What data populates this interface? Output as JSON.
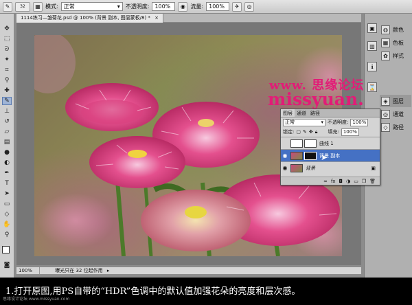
{
  "options_bar": {
    "brush_size": "32",
    "mode_label": "模式:",
    "mode_value": "正常",
    "opacity_label": "不透明度:",
    "opacity_value": "100%",
    "flow_label": "流量:",
    "flow_value": "100%"
  },
  "document": {
    "tab_title": "1114练习—雏菊花.psd @ 100% (背景 副本, 图层蒙板/8) *",
    "tab_close": "×",
    "zoom": "100%",
    "status_text": "曝光只在 32 位起作用"
  },
  "dock": {
    "items": [
      {
        "label": "颜色",
        "icon": "color-icon"
      },
      {
        "label": "色板",
        "icon": "swatches-icon"
      },
      {
        "label": "样式",
        "icon": "styles-icon"
      },
      {
        "label": "图层",
        "icon": "layers-icon"
      },
      {
        "label": "通道",
        "icon": "channels-icon"
      },
      {
        "label": "路径",
        "icon": "paths-icon"
      }
    ]
  },
  "layers_panel": {
    "tabs": [
      "图层",
      "通道",
      "路径"
    ],
    "blend_mode": "正常",
    "opacity_label": "不透明度:",
    "opacity_value": "100%",
    "lock_label": "锁定:",
    "fill_label": "填充:",
    "fill_value": "100%",
    "layers": [
      {
        "name": "曲线 1",
        "selected": false,
        "visible": false
      },
      {
        "name": "背景 副本",
        "selected": true,
        "visible": true
      },
      {
        "name": "背景",
        "selected": false,
        "visible": true
      }
    ]
  },
  "watermark": {
    "line1": "www. 思缘论坛",
    "line2": "missyuan.com"
  },
  "caption": {
    "text": "1.打开原图,用PS自带的“HDR”色调中的默认值加强花朵的亮度和层次感。"
  },
  "credit": "思缘设计论坛 www.missyuan.com"
}
